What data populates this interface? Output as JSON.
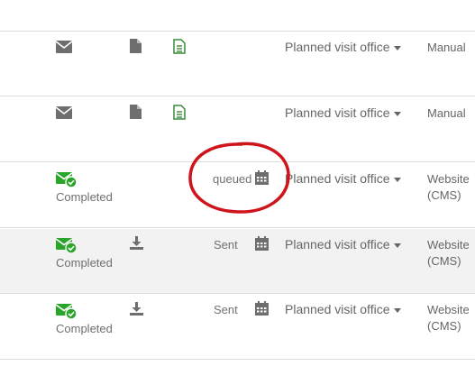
{
  "rows": [
    {
      "status": "",
      "message_icon": "envelope-icon",
      "doc_icons": [
        "file-icon",
        "file-text-icon"
      ],
      "sent": "",
      "office": "Planned visit office",
      "source_line1": "Manual",
      "source_line2": ""
    },
    {
      "status": "",
      "message_icon": "envelope-icon",
      "doc_icons": [
        "file-icon",
        "file-text-icon"
      ],
      "sent": "",
      "office": "Planned visit office",
      "source_line1": "Manual",
      "source_line2": ""
    },
    {
      "status": "Completed",
      "message_icon": "envelope-check-icon",
      "doc_icons": [],
      "sent": "queued",
      "office": "Planned visit office",
      "source_line1": "Website",
      "source_line2": "(CMS)"
    },
    {
      "status": "Completed",
      "message_icon": "envelope-check-icon",
      "doc_icons": [
        "download-icon"
      ],
      "sent": "Sent",
      "office": "Planned visit office",
      "source_line1": "Website",
      "source_line2": "(CMS)"
    },
    {
      "status": "Completed",
      "message_icon": "envelope-check-icon",
      "doc_icons": [
        "download-icon"
      ],
      "sent": "Sent",
      "office": "Planned visit office",
      "source_line1": "Website",
      "source_line2": "(CMS)"
    }
  ],
  "colors": {
    "envelope_gray": "#6e6e6e",
    "envelope_green": "#2aa52a",
    "file_text_green": "#3a8a3a",
    "annotation_red": "#d0141c",
    "row_shaded": "#f2f2f2"
  }
}
